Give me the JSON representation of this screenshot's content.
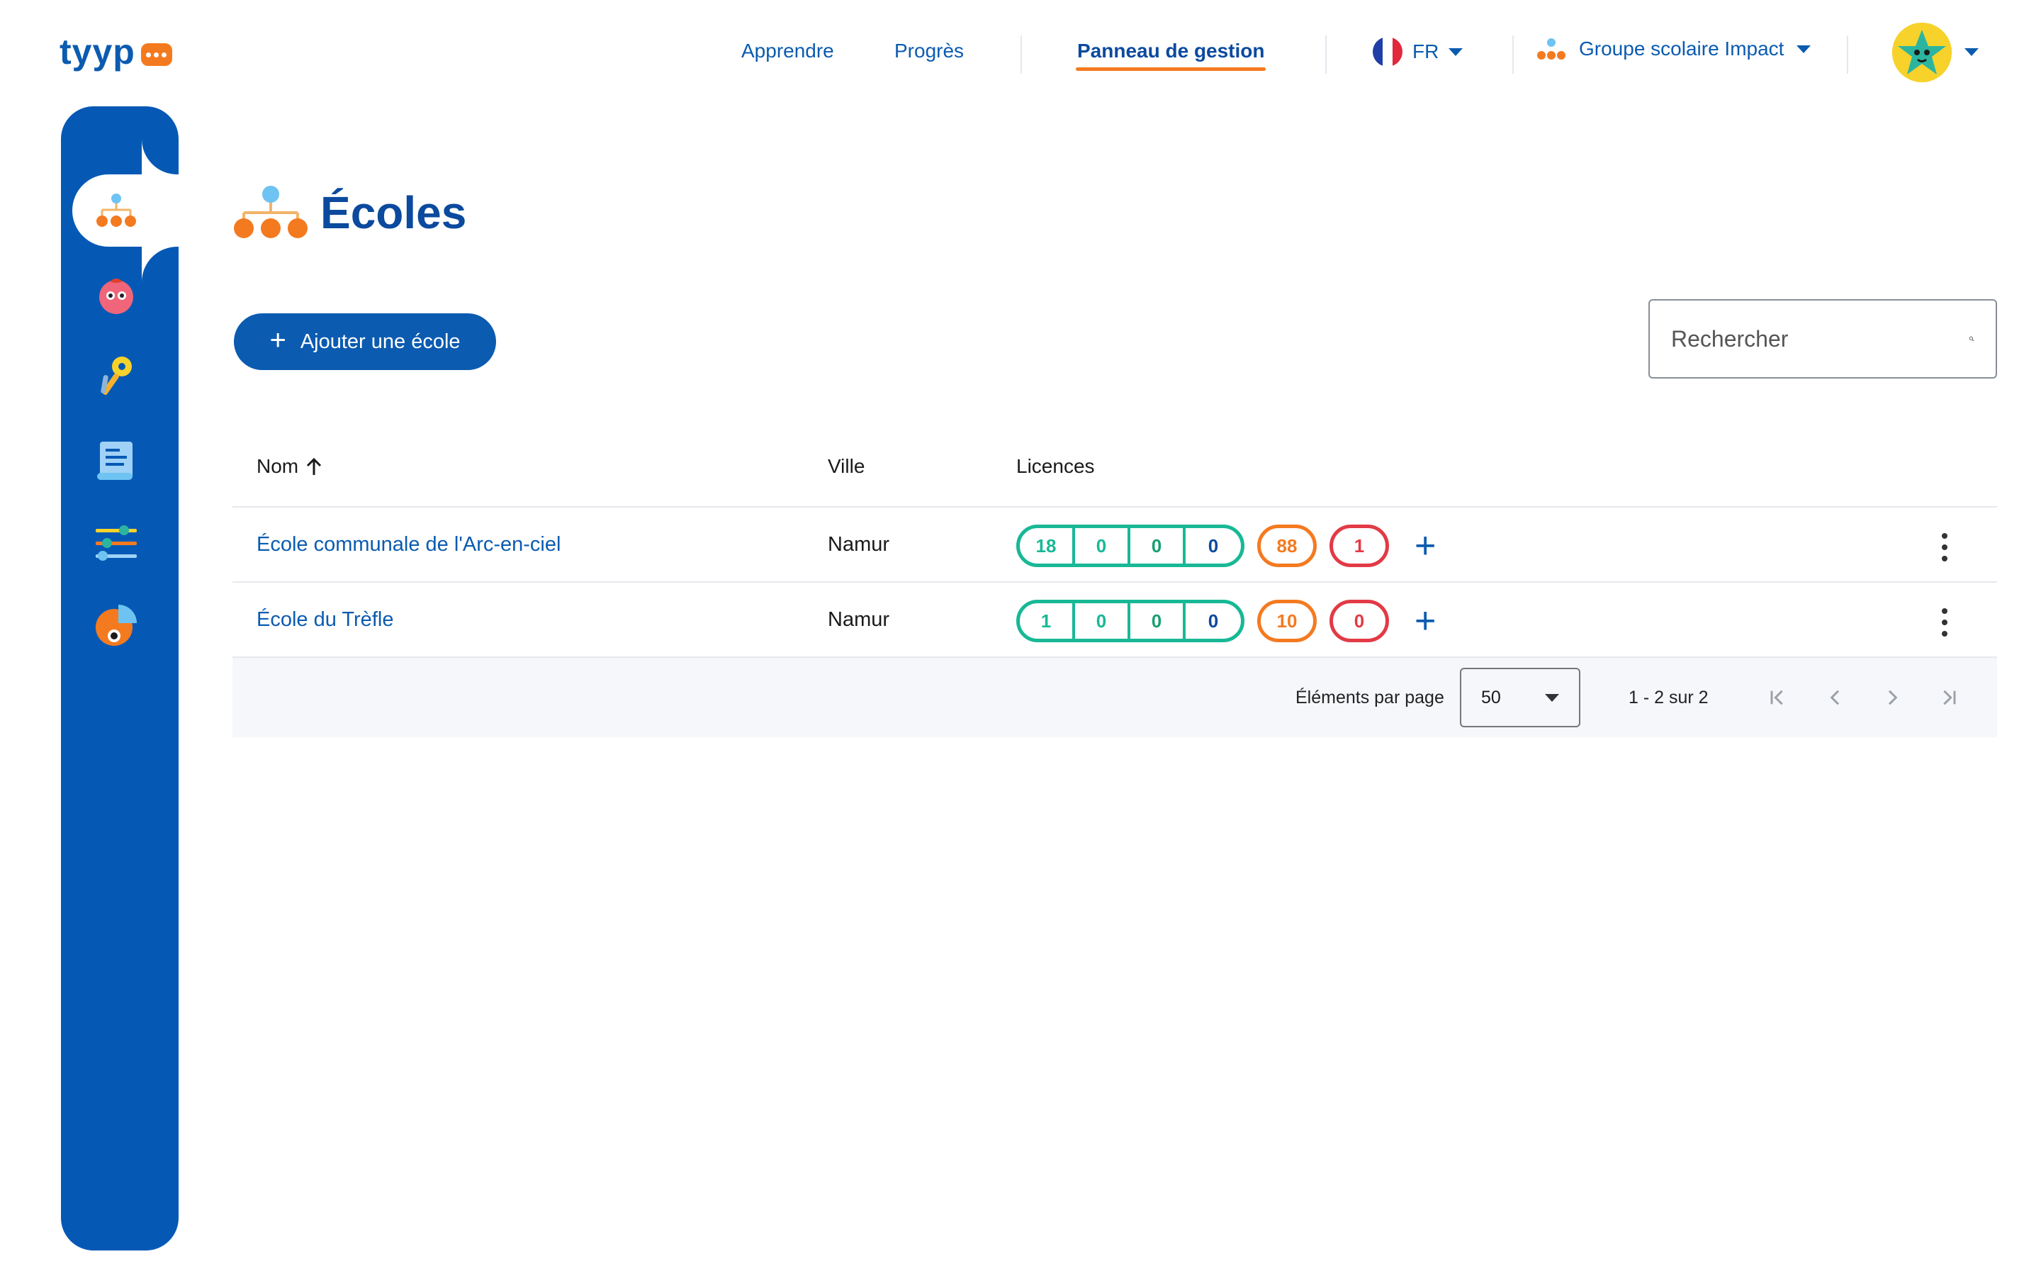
{
  "logo": {
    "text": "tyyp"
  },
  "nav": {
    "learn": "Apprendre",
    "progress": "Progrès",
    "admin": "Panneau de gestion",
    "language": "FR",
    "group": "Groupe scolaire Impact"
  },
  "page": {
    "title": "Écoles",
    "add_button": "Ajouter une école",
    "search_placeholder": "Rechercher"
  },
  "table": {
    "columns": {
      "name": "Nom",
      "city": "Ville",
      "licences": "Licences"
    },
    "rows": [
      {
        "name": "École communale de l'Arc-en-ciel",
        "city": "Namur",
        "licences": [
          "18",
          "0",
          "0",
          "0"
        ],
        "orange": "88",
        "red": "1"
      },
      {
        "name": "École du Trèfle",
        "city": "Namur",
        "licences": [
          "1",
          "0",
          "0",
          "0"
        ],
        "orange": "10",
        "red": "0"
      }
    ]
  },
  "paginator": {
    "label": "Éléments par page",
    "page_size": "50",
    "range": "1 - 2 sur 2"
  },
  "colors": {
    "primary": "#0b5bb0",
    "sidebar": "#0559b5",
    "accent": "#f47a20",
    "green": "#18b896",
    "red": "#e23a46"
  }
}
